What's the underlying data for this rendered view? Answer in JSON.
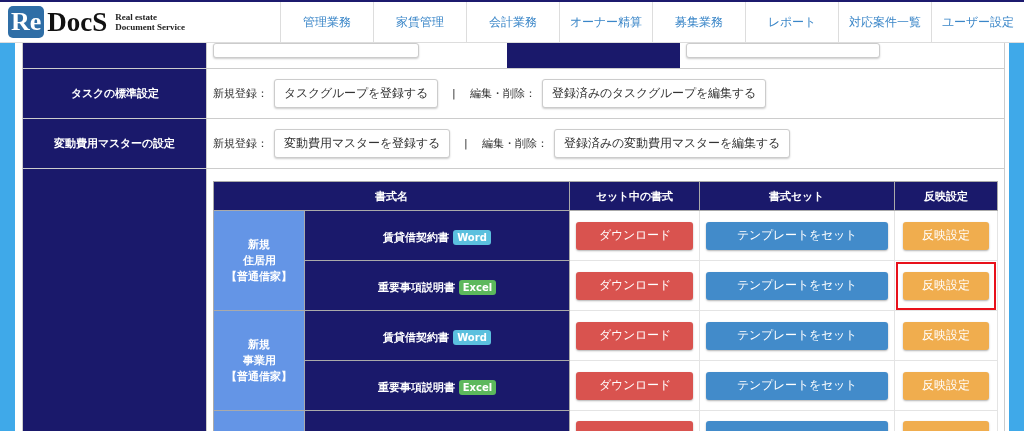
{
  "header": {
    "logo": {
      "mark": "Re",
      "name": "DocS",
      "tagline": [
        "Real estate",
        "Document Service"
      ]
    },
    "nav": [
      "管理業務",
      "家賃管理",
      "会計業務",
      "オーナー精算",
      "募集業務",
      "レポート",
      "対応案件一覧",
      "ユーザー設定"
    ]
  },
  "settings": [
    {
      "kind": "pair"
    },
    {
      "label": "タスクの標準設定",
      "kind": "register",
      "new_label": "新規登録：",
      "new_button": "タスクグループを登録する",
      "separator": "|",
      "edit_label": "編集・削除：",
      "edit_button": "登録済みのタスクグループを編集する"
    },
    {
      "label": "変動費用マスターの設定",
      "kind": "register",
      "new_label": "新規登録：",
      "new_button": "変動費用マスターを登録する",
      "separator": "|",
      "edit_label": "編集・削除：",
      "edit_button": "登録済みの変動費用マスターを編集する"
    }
  ],
  "templates": {
    "columns": [
      "書式名",
      "セット中の書式",
      "書式セット",
      "反映設定"
    ],
    "groups": [
      {
        "label": [
          "新規",
          "住居用",
          "【普通借家】"
        ],
        "rows": [
          {
            "name": "賃貸借契約書",
            "badge": "Word",
            "download": "ダウンロード",
            "set": "テンプレートをセット",
            "apply": "反映設定",
            "highlighted": false
          },
          {
            "name": "重要事項説明書",
            "badge": "Excel",
            "download": "ダウンロード",
            "set": "テンプレートをセット",
            "apply": "反映設定",
            "highlighted": true
          }
        ]
      },
      {
        "label": [
          "新規",
          "事業用",
          "【普通借家】"
        ],
        "rows": [
          {
            "name": "賃貸借契約書",
            "badge": "Word",
            "download": "ダウンロード",
            "set": "テンプレートをセット",
            "apply": "反映設定",
            "highlighted": false
          },
          {
            "name": "重要事項説明書",
            "badge": "Excel",
            "download": "ダウンロード",
            "set": "テンプレートをセット",
            "apply": "反映設定",
            "highlighted": false
          }
        ]
      },
      {
        "rows": [
          {
            "highlighted": false
          }
        ]
      }
    ]
  }
}
